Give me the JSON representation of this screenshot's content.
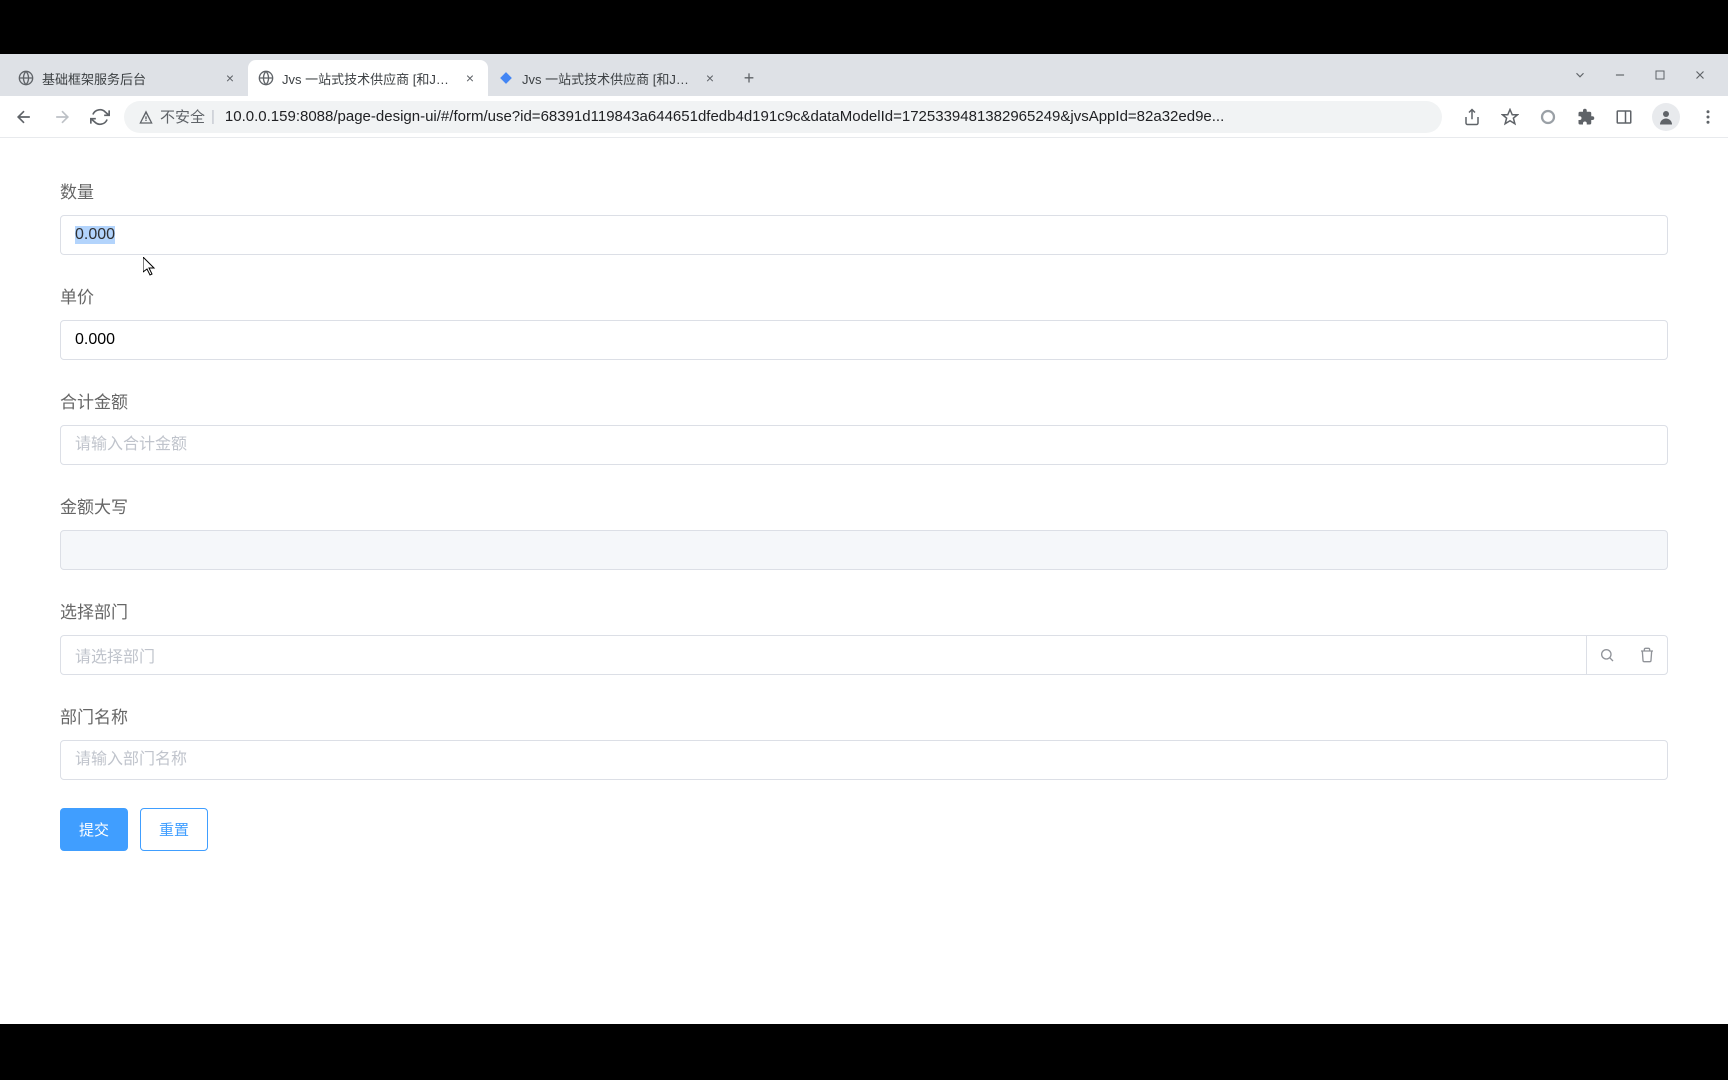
{
  "browser": {
    "tabs": [
      {
        "title": "基础框架服务后台",
        "favicon": "globe"
      },
      {
        "title": "Jvs 一站式技术供应商 [和JVS—",
        "favicon": "globe",
        "active": true
      },
      {
        "title": "Jvs 一站式技术供应商 [和JVS—",
        "favicon": "diamond"
      }
    ],
    "security_label": "不安全",
    "url": "10.0.0.159:8088/page-design-ui/#/form/use?id=68391d119843a644651dfedb4d191c9c&dataModelId=1725339481382965249&jvsAppId=82a32ed9e..."
  },
  "form": {
    "quantity": {
      "label": "数量",
      "value": "0.000"
    },
    "unit_price": {
      "label": "单价",
      "value": "0.000"
    },
    "total_amount": {
      "label": "合计金额",
      "placeholder": "请输入合计金额"
    },
    "amount_caps": {
      "label": "金额大写"
    },
    "select_dept": {
      "label": "选择部门",
      "placeholder": "请选择部门"
    },
    "dept_name": {
      "label": "部门名称",
      "placeholder": "请输入部门名称"
    },
    "submit_label": "提交",
    "reset_label": "重置"
  }
}
